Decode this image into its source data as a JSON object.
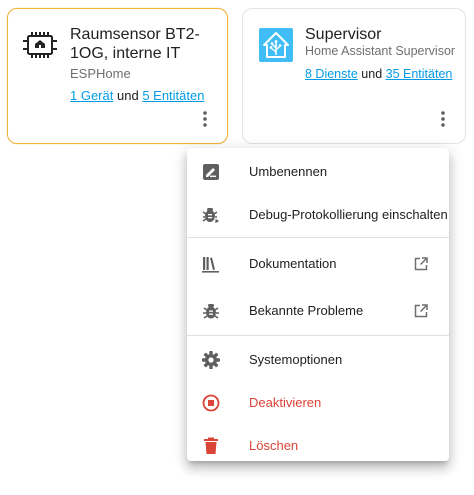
{
  "cards": {
    "esphome": {
      "title": "Raumsensor BT2-1OG, interne IT",
      "subtitle": "ESPHome",
      "devices_link": "1 Gerät",
      "conjunction": "und",
      "entities_link": "5 Entitäten",
      "menu_icon": "dots-vertical-icon",
      "logo_icon": "esphome-chip-icon",
      "accent_color": "#f0b437"
    },
    "supervisor": {
      "title": "Supervisor",
      "subtitle": "Home Assistant Supervisor",
      "services_link": "8 Dienste",
      "conjunction": "und",
      "entities_link": "35 Entitäten",
      "menu_icon": "dots-vertical-icon",
      "logo_icon": "home-assistant-logo-icon",
      "logo_color": "#41bdf5"
    }
  },
  "menu": {
    "items": [
      {
        "label": "Umbenennen",
        "icon": "rename-box-icon"
      },
      {
        "label": "Debug-Protokollierung einschalten",
        "icon": "bug-play-icon"
      },
      {
        "label": "Dokumentation",
        "icon": "bookshelf-icon",
        "external": "open-in-new-icon"
      },
      {
        "label": "Bekannte Probleme",
        "icon": "bug-icon",
        "external": "open-in-new-icon"
      },
      {
        "label": "Systemoptionen",
        "icon": "cog-icon"
      },
      {
        "label": "Deaktivieren",
        "icon": "stop-circle-icon",
        "danger": true
      },
      {
        "label": "Löschen",
        "icon": "delete-icon",
        "danger": true
      }
    ],
    "icon_color": "#5f5f5f",
    "danger_color": "#db4437"
  },
  "link_color": "#039be5"
}
